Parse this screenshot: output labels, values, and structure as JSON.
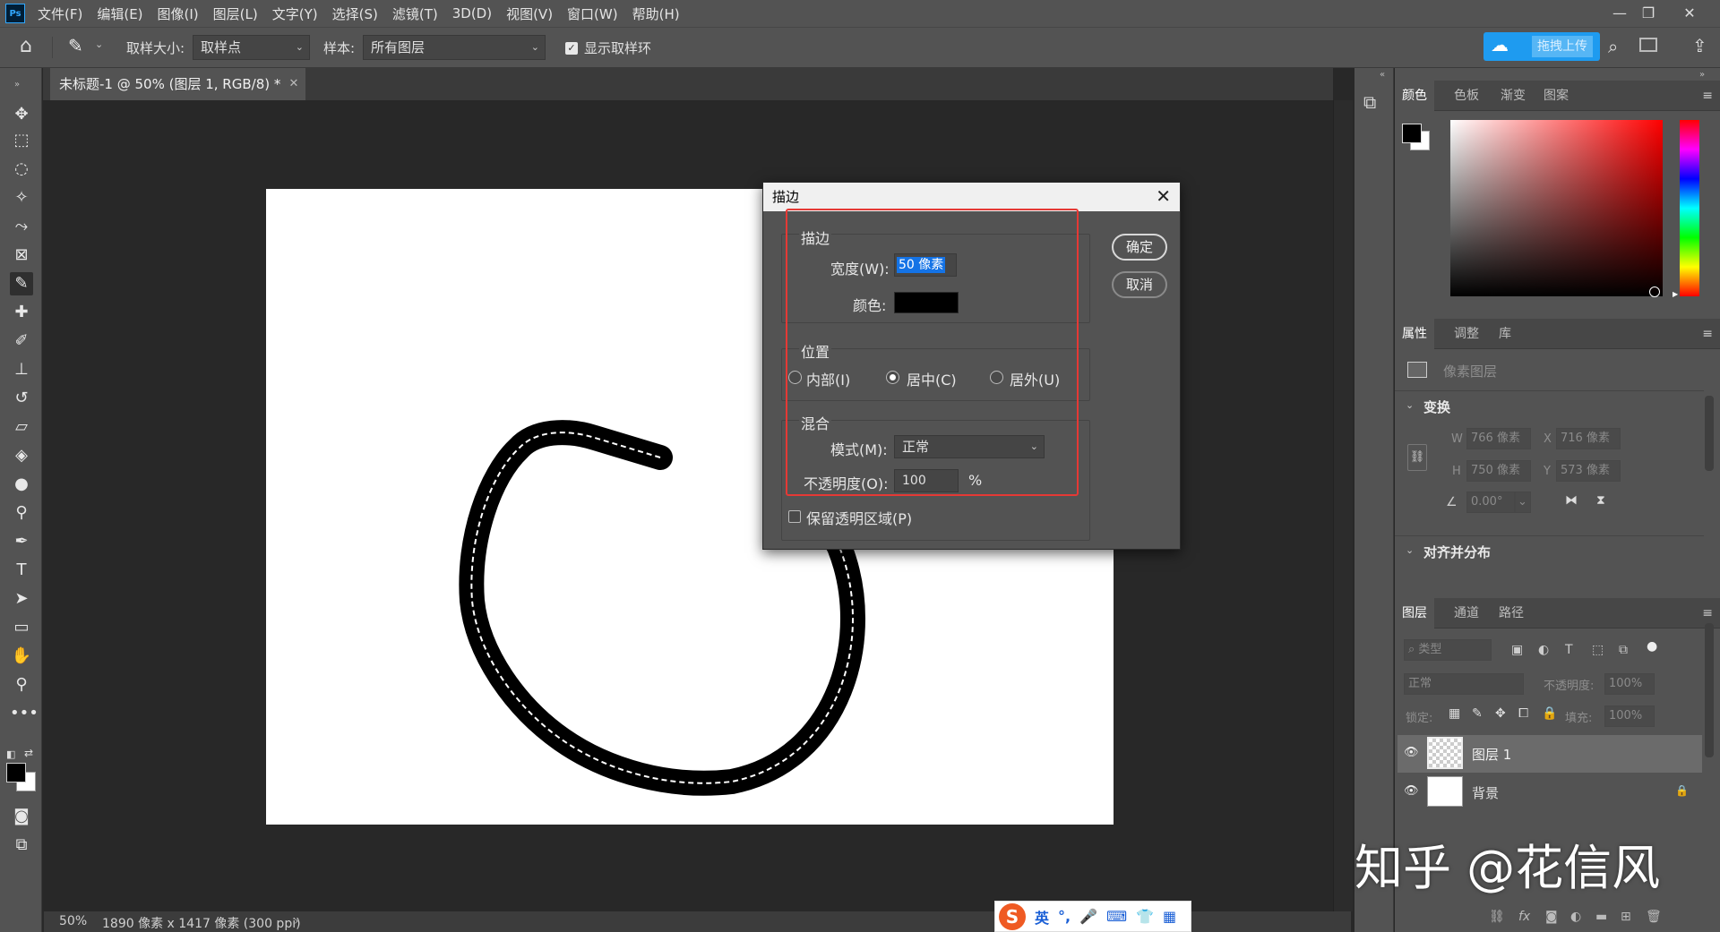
{
  "menubar": {
    "logo": "Ps",
    "items": [
      "文件(F)",
      "编辑(E)",
      "图像(I)",
      "图层(L)",
      "文字(Y)",
      "选择(S)",
      "滤镜(T)",
      "3D(D)",
      "视图(V)",
      "窗口(W)",
      "帮助(H)"
    ]
  },
  "options": {
    "sample_size_label": "取样大小:",
    "sample_size_value": "取样点",
    "sample_label": "样本:",
    "sample_value": "所有图层",
    "show_ring_label": "显示取样环",
    "upload_label": "拖拽上传"
  },
  "document": {
    "tab_title": "未标题-1 @ 50% (图层 1, RGB/8) *",
    "zoom": "50%",
    "size_info": "1890 像素 x 1417 像素 (300 ppi)"
  },
  "dialog": {
    "title": "描边",
    "stroke_group": "描边",
    "width_label": "宽度(W):",
    "width_value": "50 像素",
    "color_label": "颜色:",
    "color_value": "#000000",
    "position_group": "位置",
    "inside_label": "内部(I)",
    "center_label": "居中(C)",
    "outside_label": "居外(U)",
    "selected_position": "center",
    "blend_group": "混合",
    "mode_label": "模式(M):",
    "mode_value": "正常",
    "opacity_label": "不透明度(O):",
    "opacity_value": "100",
    "percent": "%",
    "preserve_label": "保留透明区域(P)",
    "ok_label": "确定",
    "cancel_label": "取消"
  },
  "color_panel": {
    "tabs": [
      "颜色",
      "色板",
      "渐变",
      "图案"
    ]
  },
  "properties_panel": {
    "tabs": [
      "属性",
      "调整",
      "库"
    ],
    "layer_type": "像素图层",
    "transform_title": "变换",
    "w_label": "W",
    "w_value": "766 像素",
    "x_label": "X",
    "x_value": "716 像素",
    "h_label": "H",
    "h_value": "750 像素",
    "y_label": "Y",
    "y_value": "573 像素",
    "angle_value": "0.00°",
    "align_title": "对齐并分布"
  },
  "layers_panel": {
    "tabs": [
      "图层",
      "通道",
      "路径"
    ],
    "filter_placeholder": "类型",
    "blend_mode": "正常",
    "opacity_label": "不透明度:",
    "opacity_value": "100%",
    "lock_label": "锁定:",
    "fill_label": "填充:",
    "fill_value": "100%",
    "layers": [
      {
        "name": "图层 1"
      },
      {
        "name": "背景"
      }
    ]
  },
  "ime": {
    "mode": "英"
  },
  "watermark": "知乎 @花信风"
}
